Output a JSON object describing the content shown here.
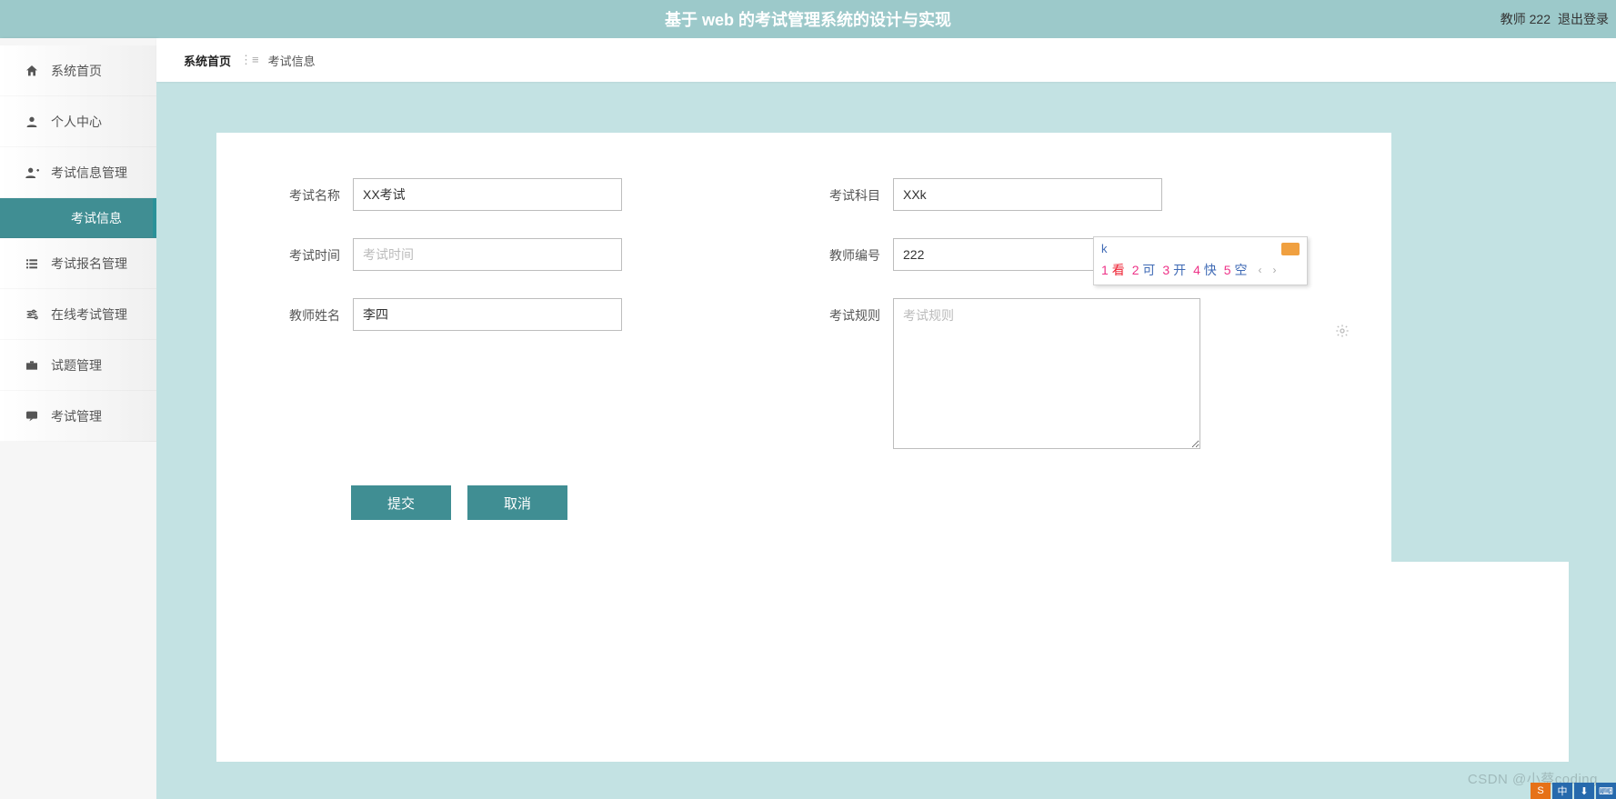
{
  "header": {
    "title": "基于 web 的考试管理系统的设计与实现",
    "user_label": "教师 222",
    "logout_label": "退出登录"
  },
  "sidebar": {
    "items": [
      {
        "icon": "home",
        "label": "系统首页"
      },
      {
        "icon": "person",
        "label": "个人中心"
      },
      {
        "icon": "person_add",
        "label": "考试信息管理"
      },
      {
        "icon": "list",
        "label": "考试报名管理"
      },
      {
        "icon": "tune",
        "label": "在线考试管理"
      },
      {
        "icon": "work",
        "label": "试题管理"
      },
      {
        "icon": "chat",
        "label": "考试管理"
      }
    ],
    "active_sub": "考试信息"
  },
  "breadcrumb": {
    "root": "系统首页",
    "sep": "⋮≡",
    "current": "考试信息"
  },
  "form": {
    "exam_name_label": "考试名称",
    "exam_name_value": "XX考试",
    "exam_subject_label": "考试科目",
    "exam_subject_value": "XXk",
    "exam_time_label": "考试时间",
    "exam_time_placeholder": "考试时间",
    "exam_time_value": "",
    "teacher_id_label": "教师编号",
    "teacher_id_value": "222",
    "teacher_name_label": "教师姓名",
    "teacher_name_value": "李四",
    "exam_rule_label": "考试规则",
    "exam_rule_placeholder": "考试规则",
    "exam_rule_value": ""
  },
  "buttons": {
    "submit": "提交",
    "cancel": "取消"
  },
  "ime": {
    "composition": "k",
    "candidates": [
      {
        "n": "1",
        "w": "看"
      },
      {
        "n": "2",
        "w": "可"
      },
      {
        "n": "3",
        "w": "开"
      },
      {
        "n": "4",
        "w": "快"
      },
      {
        "n": "5",
        "w": "空"
      }
    ],
    "prev": "‹",
    "next": "›"
  },
  "watermark": "CSDN @小蔡coding",
  "taskbar": {
    "a": "S",
    "b": "中",
    "c": "⬇",
    "d": "⌨"
  }
}
